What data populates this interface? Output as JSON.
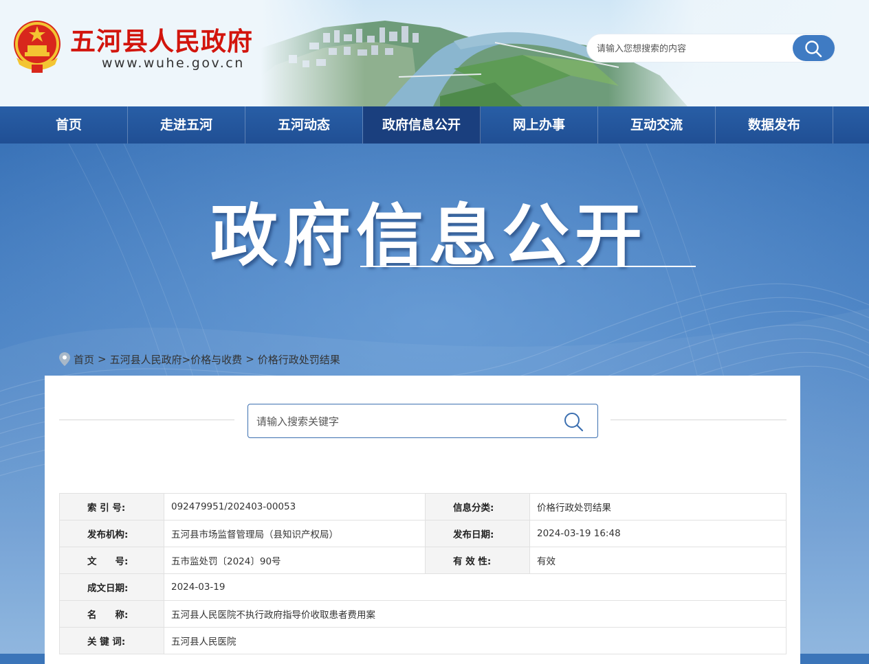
{
  "header": {
    "site_title": "五河县人民政府",
    "site_url": "www.wuhe.gov.cn",
    "search_placeholder": "请输入您想搜索的内容"
  },
  "nav": {
    "items": [
      "首页",
      "走进五河",
      "五河动态",
      "政府信息公开",
      "网上办事",
      "互动交流",
      "数据发布"
    ],
    "active_index": 3
  },
  "banner": {
    "title": "政府信息公开"
  },
  "breadcrumb": {
    "home": "首页",
    "sep": ">",
    "level1": "五河县人民政府",
    "level2": ">价格与收费",
    "level3": "价格行政处罚结果"
  },
  "content": {
    "search_placeholder": "请输入搜索关键字",
    "info": {
      "index_label": "索 引 号:",
      "index_value": "092479951/202403-00053",
      "category_label": "信息分类:",
      "category_value": "价格行政处罚结果",
      "publisher_label": "发布机构:",
      "publisher_value": "五河县市场监督管理局（县知识产权局）",
      "publish_date_label": "发布日期:",
      "publish_date_value": "2024-03-19 16:48",
      "doc_no_label": "文　　号:",
      "doc_no_value": "五市监处罚〔2024〕90号",
      "validity_label": "有 效 性:",
      "validity_value": "有效",
      "created_label": "成文日期:",
      "created_value": "2024-03-19",
      "name_label": "名　　称:",
      "name_value": "五河县人民医院不执行政府指导价收取患者费用案",
      "keywords_label": "关 键 词:",
      "keywords_value": "五河县人民医院"
    }
  },
  "colors": {
    "nav_bg": "#2456a0",
    "nav_active": "#1a3f7e",
    "title_red": "#d2150d",
    "search_btn": "#3f7bc3"
  }
}
